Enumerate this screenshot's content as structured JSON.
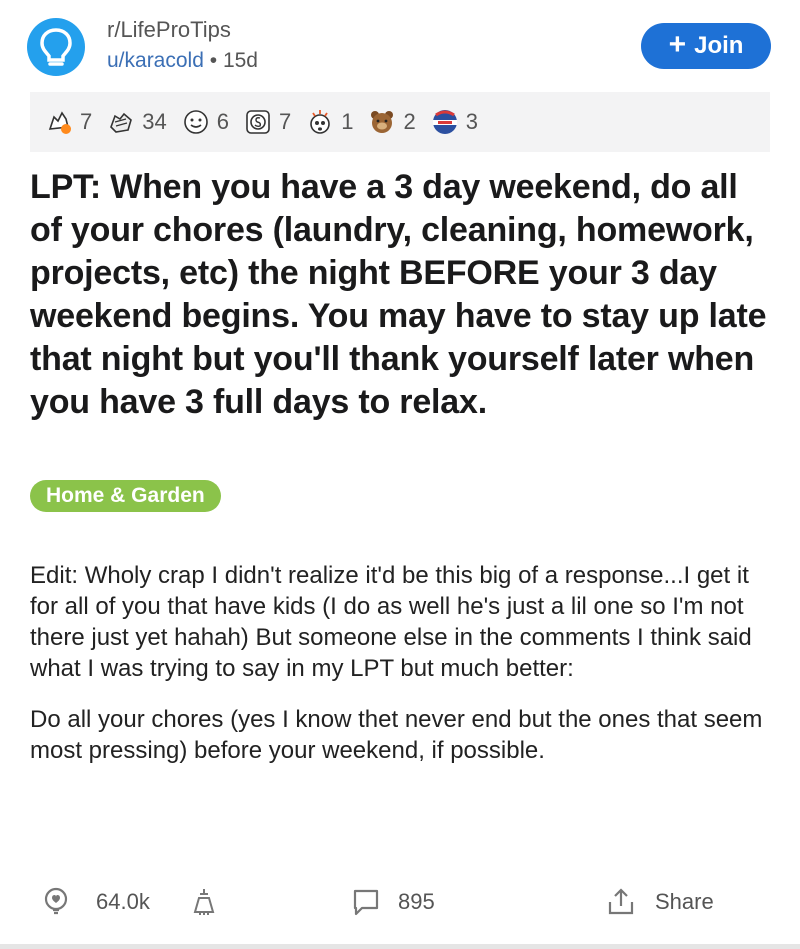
{
  "post": {
    "subreddit": "r/LifeProTips",
    "author": "u/karacold",
    "separator": "•",
    "age": "15d",
    "join_label": "Join",
    "awards": [
      {
        "icon": "take-my-energy-icon",
        "count": "7"
      },
      {
        "icon": "helpful-hands-icon",
        "count": "34"
      },
      {
        "icon": "wholesome-icon",
        "count": "6"
      },
      {
        "icon": "silver-award-icon",
        "count": "7"
      },
      {
        "icon": "mind-blown-icon",
        "count": "1"
      },
      {
        "icon": "bear-award-icon",
        "count": "2"
      },
      {
        "icon": "vote-badge-icon",
        "count": "3"
      }
    ],
    "title": "LPT: When you have a 3 day weekend, do all of your chores (laundry, cleaning, homework, projects, etc) the night BEFORE your 3 day weekend begins. You may have to stay up late that night but you'll thank yourself later when you have 3 full days to relax.",
    "flair": "Home & Garden",
    "body": [
      "Edit: Wholy crap I didn't realize it'd be this big of a response...I get it for all of you that have kids (I do as well he's just a lil one so I'm not there just yet hahah) But someone else in the comments I think said what I was trying to say in my LPT but much better:",
      "Do all your chores (yes I know thet never end but the ones that seem most pressing) before your weekend, if possible."
    ],
    "actions": {
      "score": "64.0k",
      "comments": "895",
      "share_label": "Share"
    }
  },
  "colors": {
    "join_bg": "#1e71d6",
    "avatar_bg": "#24a0ed",
    "flair_bg": "#8bc34a",
    "author_link": "#3b6fb5"
  }
}
